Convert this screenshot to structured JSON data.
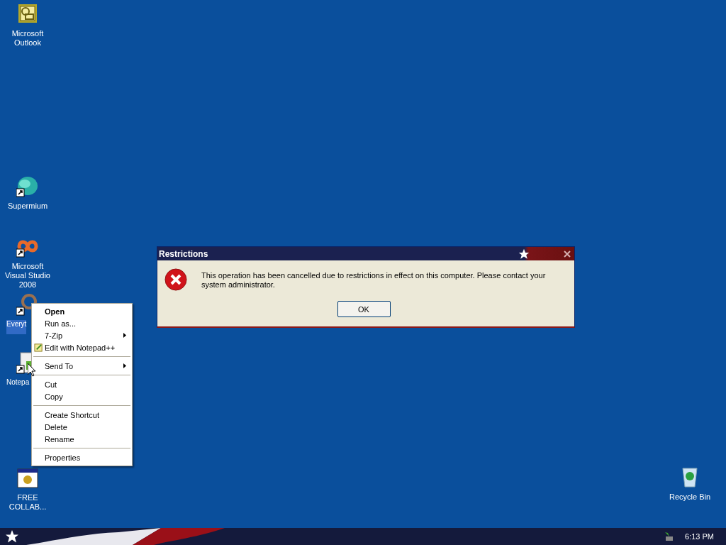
{
  "desktop_icons": [
    {
      "label": "Microsoft Outlook",
      "kind": "outlook",
      "shortcut": false,
      "selected": false
    },
    {
      "label": "Supermium",
      "kind": "globe",
      "shortcut": true,
      "selected": false
    },
    {
      "label": "Microsoft Visual Studio 2008",
      "kind": "infinity",
      "shortcut": true,
      "selected": false
    },
    {
      "label": "Everyt",
      "kind": "ring",
      "shortcut": true,
      "selected": true
    },
    {
      "label": "Notepa",
      "kind": "notepad",
      "shortcut": true,
      "selected": false
    },
    {
      "label": "FREE COLLAB...",
      "kind": "window",
      "shortcut": false,
      "selected": false
    },
    {
      "label": "Recycle Bin",
      "kind": "bin",
      "shortcut": false,
      "selected": false
    }
  ],
  "context_menu": {
    "items": [
      {
        "kind": "item",
        "label": "Open",
        "default": true,
        "submenu": false,
        "icon": false
      },
      {
        "kind": "item",
        "label": "Run as...",
        "default": false,
        "submenu": false,
        "icon": false
      },
      {
        "kind": "item",
        "label": "7-Zip",
        "default": false,
        "submenu": true,
        "icon": false
      },
      {
        "kind": "item",
        "label": "Edit with Notepad++",
        "default": false,
        "submenu": false,
        "icon": true
      },
      {
        "kind": "separator"
      },
      {
        "kind": "item",
        "label": "Send To",
        "default": false,
        "submenu": true,
        "icon": false
      },
      {
        "kind": "separator"
      },
      {
        "kind": "item",
        "label": "Cut",
        "default": false,
        "submenu": false,
        "icon": false
      },
      {
        "kind": "item",
        "label": "Copy",
        "default": false,
        "submenu": false,
        "icon": false
      },
      {
        "kind": "separator"
      },
      {
        "kind": "item",
        "label": "Create Shortcut",
        "default": false,
        "submenu": false,
        "icon": false
      },
      {
        "kind": "item",
        "label": "Delete",
        "default": false,
        "submenu": false,
        "icon": false
      },
      {
        "kind": "item",
        "label": "Rename",
        "default": false,
        "submenu": false,
        "icon": false
      },
      {
        "kind": "separator"
      },
      {
        "kind": "item",
        "label": "Properties",
        "default": false,
        "submenu": false,
        "icon": false
      }
    ]
  },
  "dialog": {
    "title": "Restrictions",
    "message": "This operation has been cancelled due to restrictions in effect on this computer. Please contact your system administrator.",
    "buttons": [
      "OK"
    ]
  },
  "taskbar": {
    "clock": "6:13 PM"
  }
}
